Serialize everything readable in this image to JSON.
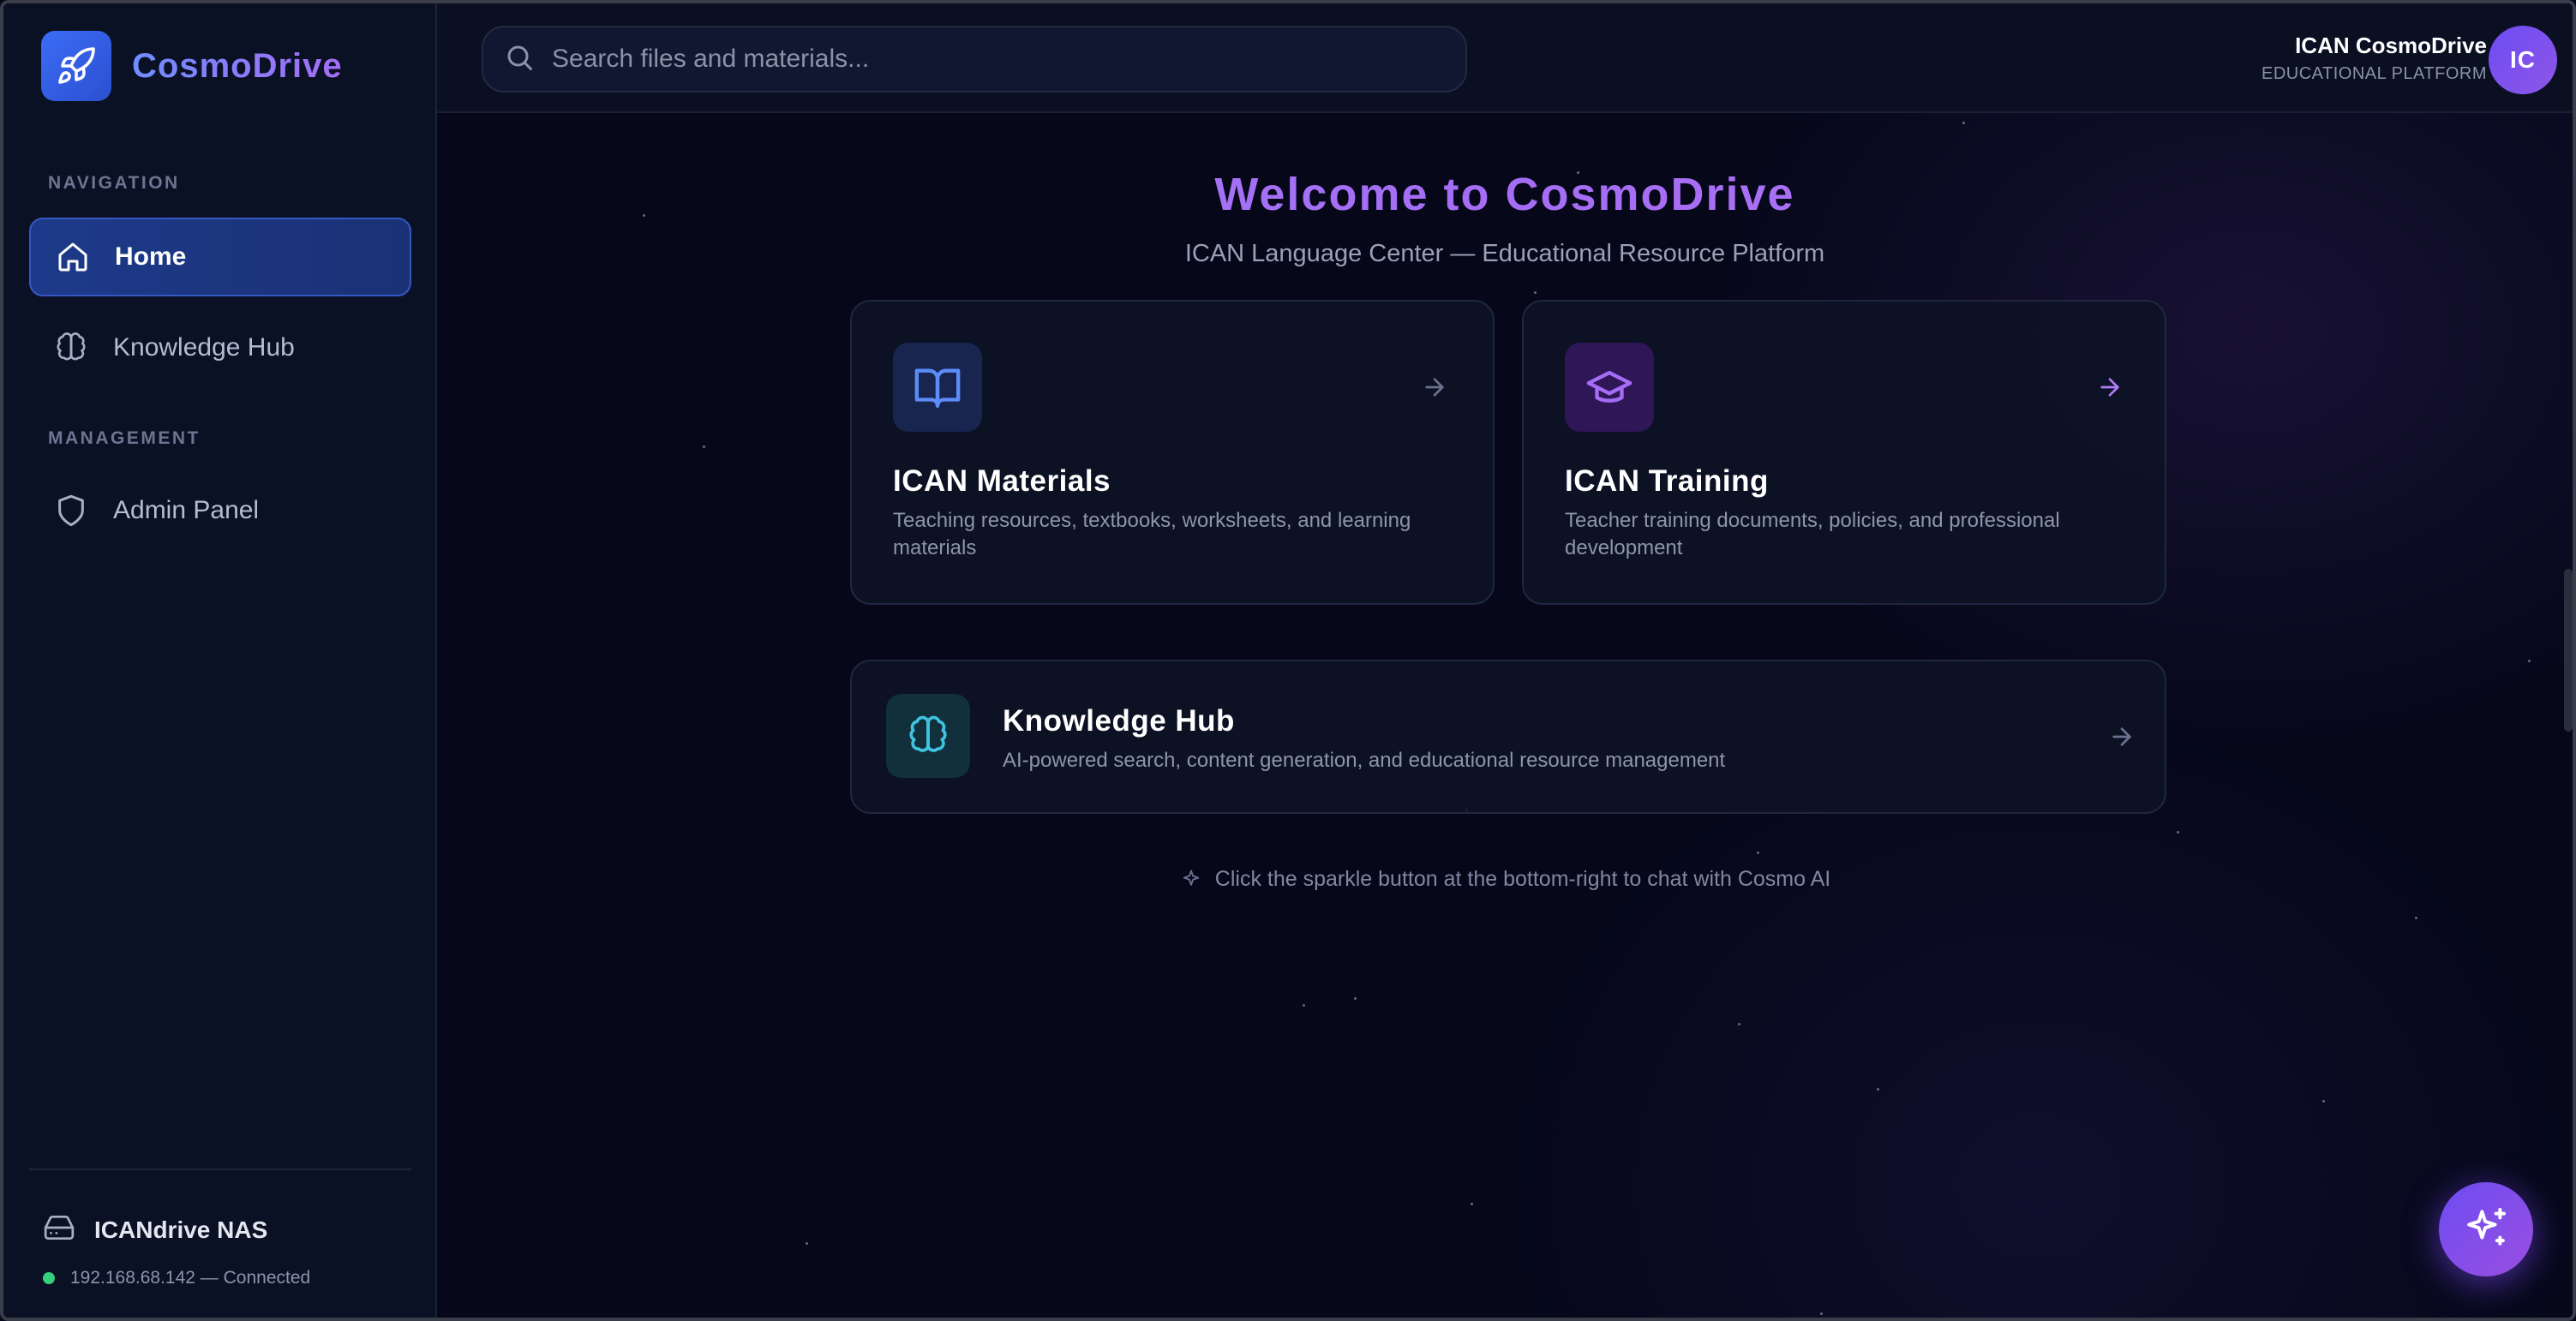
{
  "brand": {
    "name": "CosmoDrive",
    "logo_icon": "rocket-icon"
  },
  "sidebar": {
    "sections": [
      {
        "label": "NAVIGATION"
      },
      {
        "label": "MANAGEMENT"
      }
    ],
    "items": [
      {
        "label": "Home",
        "icon": "home-icon",
        "active": true
      },
      {
        "label": "Knowledge Hub",
        "icon": "brain-icon",
        "active": false
      },
      {
        "label": "Admin Panel",
        "icon": "shield-icon",
        "active": false
      }
    ],
    "nas": {
      "name": "ICANdrive NAS",
      "status": "192.168.68.142 — Connected",
      "status_color": "#34d17a"
    }
  },
  "topbar": {
    "search_placeholder": "Search files and materials...",
    "user_name": "ICAN CosmoDrive",
    "user_sub": "EDUCATIONAL PLATFORM",
    "avatar_initials": "IC"
  },
  "main": {
    "title": "Welcome to CosmoDrive",
    "subtitle": "ICAN Language Center — Educational Resource Platform",
    "cards": [
      {
        "title": "ICAN Materials",
        "desc": "Teaching resources, textbooks, worksheets, and learning materials",
        "icon": "book-open-icon"
      },
      {
        "title": "ICAN Training",
        "desc": "Teacher training documents, policies, and professional development",
        "icon": "graduation-cap-icon"
      }
    ],
    "wide_card": {
      "title": "Knowledge Hub",
      "desc": "AI-powered search, content generation, and educational resource management",
      "icon": "brain-icon"
    },
    "hint": "Click the sparkle button at the bottom-right to chat with Cosmo AI"
  },
  "colors": {
    "accent": "#3b6cf6",
    "purple": "#8e56e8",
    "background": "#06081a"
  }
}
